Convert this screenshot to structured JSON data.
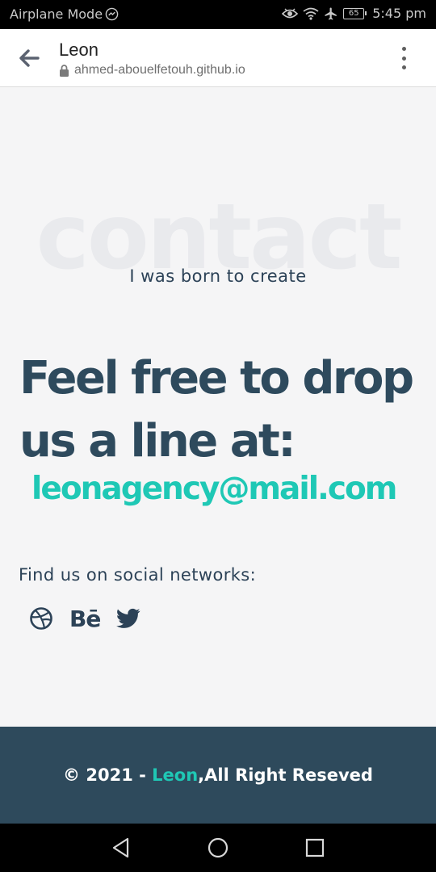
{
  "status_bar": {
    "mode_label": "Airplane Mode",
    "battery_level": "65",
    "time": "5:45 pm"
  },
  "browser": {
    "page_title": "Leon",
    "url": "ahmed-abouelfetouh.github.io"
  },
  "contact": {
    "watermark": "contact",
    "subtitle": "I was born to create",
    "headline_line1": "Feel free to drop",
    "headline_line2": "us a line at:",
    "email": "leonagency@mail.com",
    "social_label": "Find us on social networks:",
    "social_icons": [
      "dribbble-icon",
      "behance-icon",
      "twitter-icon"
    ],
    "behance_text": "Bē"
  },
  "footer": {
    "copyright_prefix": "© 2021 - ",
    "brand": "Leon",
    "copyright_suffix": ",All Right Reseved"
  },
  "colors": {
    "accent": "#1fc8b5",
    "heading": "#2e4a5d",
    "footer_bg": "#2e4a5c",
    "page_bg": "#f5f5f6"
  }
}
